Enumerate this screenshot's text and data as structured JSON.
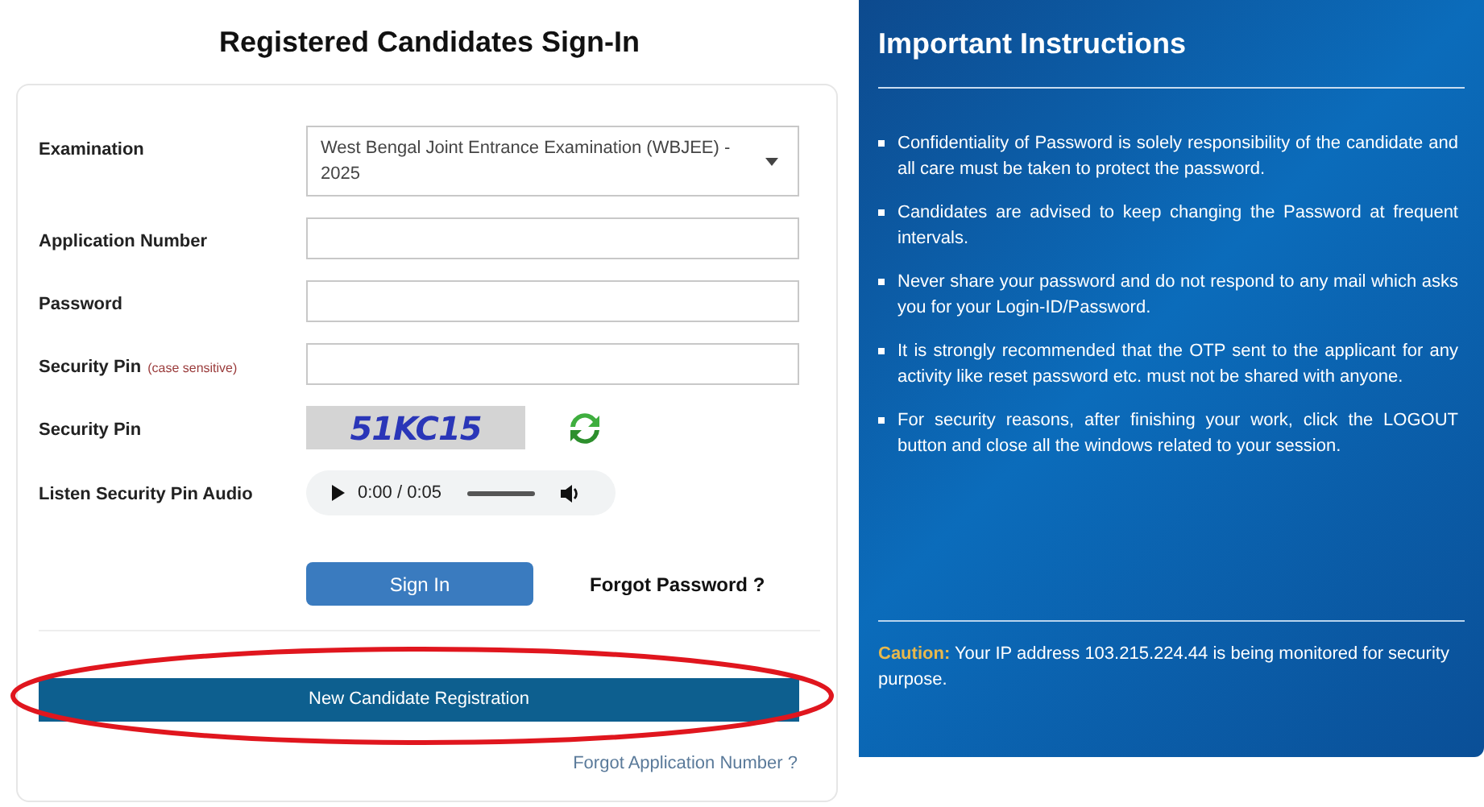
{
  "signin": {
    "title": "Registered Candidates Sign-In",
    "fields": [
      {
        "kind": "select",
        "label": "Examination",
        "value": "West Bengal Joint Entrance Examination (WBJEE) - 2025"
      },
      {
        "kind": "input",
        "label": "Application Number"
      },
      {
        "kind": "input",
        "label": "Password"
      },
      {
        "kind": "input",
        "label": "Security Pin",
        "hint": "(case sensitive)"
      },
      {
        "kind": "captcha",
        "label": "Security Pin",
        "value": "51KC15"
      },
      {
        "kind": "audio",
        "label": "Listen Security Pin Audio",
        "time": "0:00 / 0:05"
      }
    ],
    "sign_in_button": "Sign In",
    "forgot_password": "Forgot Password ?",
    "register_button": "New Candidate Registration",
    "forgot_application": "Forgot Application Number ?"
  },
  "instructions": {
    "title": "Important Instructions",
    "items": [
      "Confidentiality of Password is solely responsibility of the candidate and all care must be taken to protect the password.",
      "Candidates are advised to keep changing the Password at frequent intervals.",
      "Never share your password and do not respond to any mail which asks you for your Login-ID/Password.",
      "It is strongly recommended that the OTP sent to the applicant for any activity like reset password etc. must not be shared with anyone.",
      "For security reasons, after finishing your work, click the LOGOUT button and close all the windows related to your session."
    ],
    "caution": {
      "label": "Caution:",
      "text": "Your IP address 103.215.224.44 is being monitored for security purpose."
    }
  }
}
